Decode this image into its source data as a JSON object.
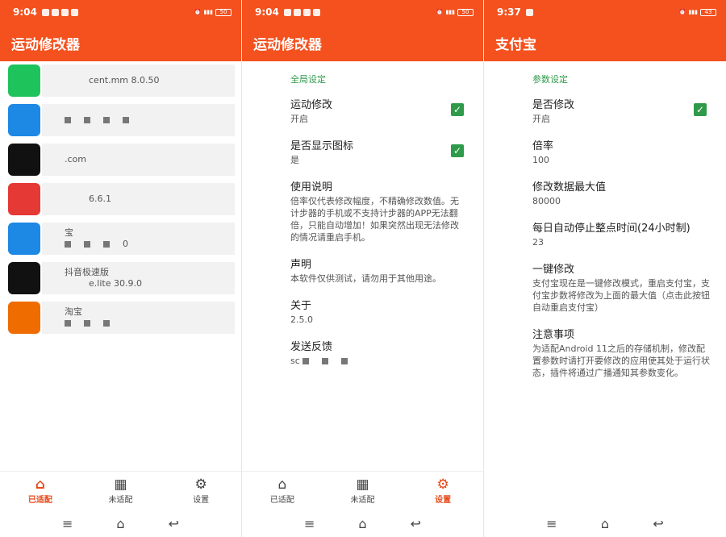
{
  "screens": [
    {
      "status": {
        "time": "9:04",
        "battery": "50"
      },
      "title": "运动修改器",
      "apps": [
        {
          "name": "",
          "version": "cent.mm 8.0.50",
          "icon_color": "#1fc35b"
        },
        {
          "name": "",
          "version": "",
          "icon_color": "#1e88e5"
        },
        {
          "name": "",
          "version": ".com",
          "icon_color": "#111111"
        },
        {
          "name": "",
          "version": "6.6.1",
          "icon_color": "#e53935"
        },
        {
          "name": "宝",
          "version": "0",
          "icon_color": "#1e88e5"
        },
        {
          "name": "抖音极速版",
          "version": "e.lite 30.9.0",
          "icon_color": "#111111"
        },
        {
          "name": "淘宝",
          "version": "",
          "icon_color": "#ef6c00"
        }
      ],
      "nav": [
        {
          "label": "已适配",
          "icon": "home-icon",
          "active": true
        },
        {
          "label": "未适配",
          "icon": "grid-icon",
          "active": false
        },
        {
          "label": "设置",
          "icon": "gear-icon",
          "active": false
        }
      ]
    },
    {
      "status": {
        "time": "9:04",
        "battery": "50"
      },
      "title": "运动修改器",
      "section": "全局设定",
      "prefs": [
        {
          "title": "运动修改",
          "summary": "开启",
          "checked": true
        },
        {
          "title": "是否显示图标",
          "summary": "是",
          "checked": true
        },
        {
          "title": "使用说明",
          "summary": "倍率仅代表修改幅度，不精确修改数值。无计步器的手机或不支持计步器的APP无法翻倍，只能自动增加！如果突然出现无法修改的情况请重启手机。"
        },
        {
          "title": "声明",
          "summary": "本软件仅供测试，请勿用于其他用途。"
        },
        {
          "title": "关于",
          "summary": "2.5.0"
        },
        {
          "title": "发送反馈",
          "summary": "sc"
        }
      ],
      "nav": [
        {
          "label": "已适配",
          "icon": "home-icon",
          "active": false
        },
        {
          "label": "未适配",
          "icon": "grid-icon",
          "active": false
        },
        {
          "label": "设置",
          "icon": "gear-icon",
          "active": true
        }
      ]
    },
    {
      "status": {
        "time": "9:37",
        "battery": "43"
      },
      "title": "支付宝",
      "section": "参数设定",
      "prefs": [
        {
          "title": "是否修改",
          "summary": "开启",
          "checked": true
        },
        {
          "title": "倍率",
          "summary": "100"
        },
        {
          "title": "修改数据最大值",
          "summary": "80000"
        },
        {
          "title": "每日自动停止整点时间(24小时制)",
          "summary": "23"
        },
        {
          "title": "一键修改",
          "summary": "支付宝现在是一键修改模式，重启支付宝，支付宝步数将修改为上面的最大值（点击此按钮自动重启支付宝）"
        },
        {
          "title": "注意事项",
          "summary": "为适配Android 11之后的存储机制，修改配置参数时请打开要修改的应用使其处于运行状态，插件将通过广播通知其参数变化。"
        }
      ]
    }
  ],
  "colors": {
    "primary": "#f4511e",
    "accent_green": "#2e9a4a",
    "nav_active": "#e64a19"
  }
}
